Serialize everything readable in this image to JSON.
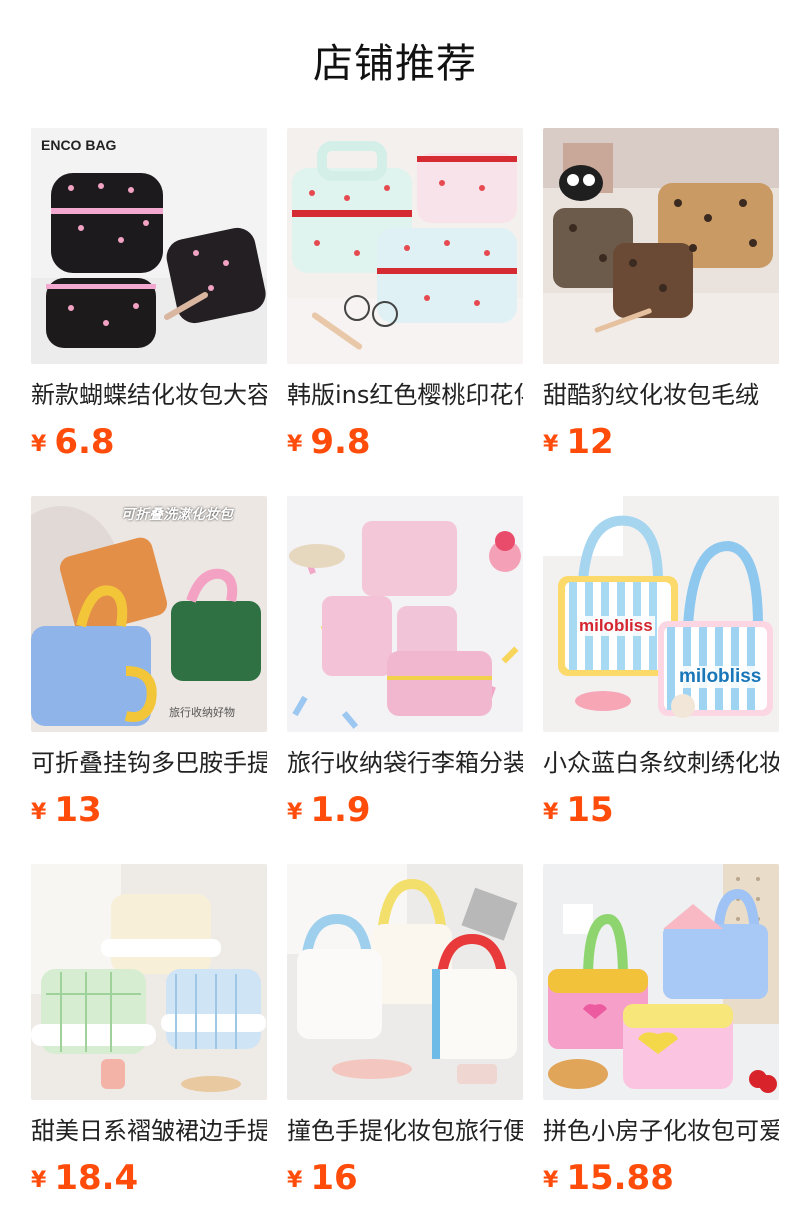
{
  "header": {
    "title": "店铺推荐"
  },
  "currency": "¥",
  "products": [
    {
      "title": "新款蝴蝶结化妆包大容量",
      "price": "6.8",
      "image_text": "ENCO BAG"
    },
    {
      "title": "韩版ins红色樱桃印花化妆包",
      "price": "9.8"
    },
    {
      "title": "甜酷豹纹化妆包毛绒",
      "price": "12"
    },
    {
      "title": "可折叠挂钩多巴胺手提化妆包",
      "price": "13",
      "image_text": "可折叠洗漱化妆包",
      "image_caption": "旅行收纳好物"
    },
    {
      "title": "旅行收纳袋行李箱分装",
      "price": "1.9"
    },
    {
      "title": "小众蓝白条纹刺绣化妆包",
      "price": "15",
      "image_text": "milobliss"
    },
    {
      "title": "甜美日系褶皱裙边手提",
      "price": "18.4"
    },
    {
      "title": "撞色手提化妆包旅行便携",
      "price": "16"
    },
    {
      "title": "拼色小房子化妆包可爱",
      "price": "15.88"
    }
  ]
}
